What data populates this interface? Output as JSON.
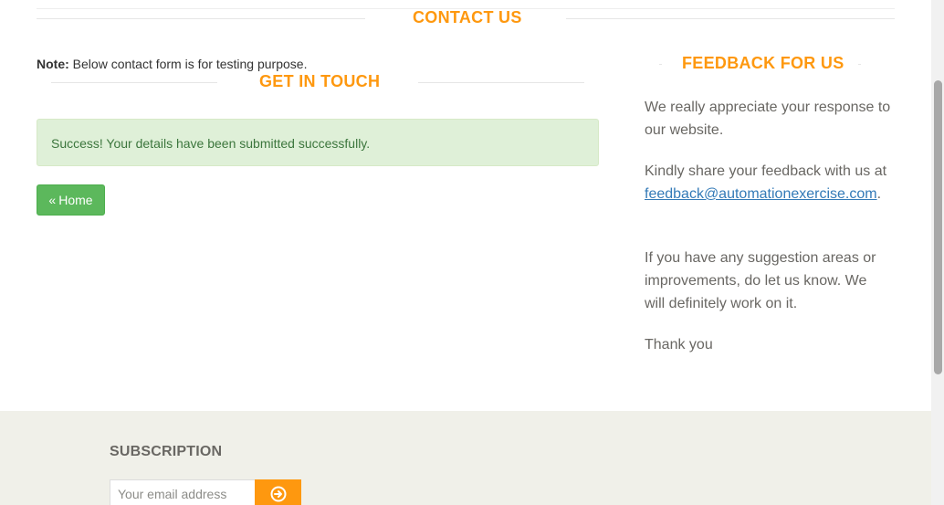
{
  "contact": {
    "title": "CONTACT US",
    "note_label": "Note:",
    "note_text": " Below contact form is for testing purpose."
  },
  "get_in_touch": {
    "title": "GET IN TOUCH",
    "alert_text": "Success! Your details have been submitted successfully.",
    "home_button": {
      "icon": "double-chevron-left-icon",
      "label": "Home"
    }
  },
  "feedback": {
    "title": "FEEDBACK FOR US",
    "p1": "We really appreciate your response to our website.",
    "p2_pre": "Kindly share your feedback with us at",
    "p2_email": "feedback@automationexercise.com",
    "p2_post": ".",
    "p3": "If you have any suggestion areas or improvements, do let us know. We will definitely work on it.",
    "p4": "Thank you"
  },
  "footer": {
    "subscription_title": "SUBSCRIPTION",
    "email_placeholder": "Your email address",
    "subscribe_icon": "arrow-circle-right-icon"
  },
  "colors": {
    "accent": "#FE980F",
    "success_bg": "#dff0d8",
    "success_text": "#3c763d",
    "button_green": "#5cb85c",
    "link": "#337ab7",
    "footer_bg": "#f0f0e9"
  }
}
